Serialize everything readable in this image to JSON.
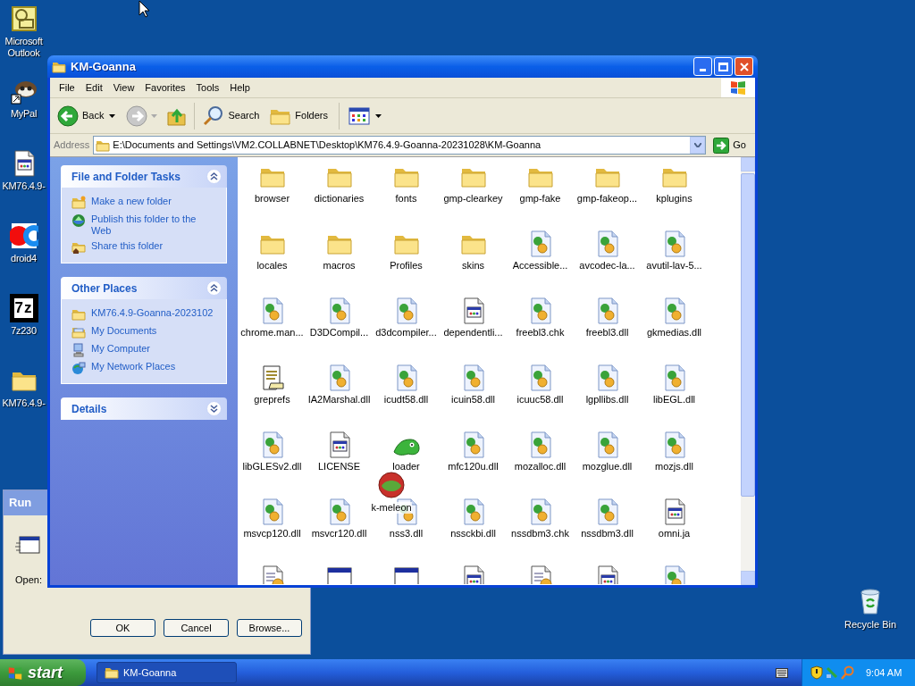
{
  "desktop_icons": [
    {
      "label": "Microsoft Outlook",
      "kind": "outlook"
    },
    {
      "label": "MyPal",
      "kind": "mypal"
    },
    {
      "label": "KM76.4.9-",
      "kind": "program"
    },
    {
      "label": "droid4",
      "kind": "droid"
    },
    {
      "label": "7z230",
      "kind": "sevenzip",
      "logo_text": "7z"
    },
    {
      "label": "KM76.4.9-",
      "kind": "folder"
    }
  ],
  "recycle_bin": {
    "label": "Recycle Bin"
  },
  "run_dialog": {
    "title": "Run",
    "open_label": "Open:",
    "buttons": [
      "OK",
      "Cancel",
      "Browse..."
    ]
  },
  "explorer": {
    "title": "KM-Goanna",
    "menu": [
      "File",
      "Edit",
      "View",
      "Favorites",
      "Tools",
      "Help"
    ],
    "toolbar": {
      "back": "Back",
      "search": "Search",
      "folders": "Folders"
    },
    "address": {
      "label": "Address",
      "value": "E:\\Documents and Settings\\VM2.COLLABNET\\Desktop\\KM76.4.9-Goanna-20231028\\KM-Goanna",
      "go": "Go"
    },
    "task_panels": [
      {
        "title": "File and Folder Tasks",
        "expanded": true,
        "items": [
          {
            "label": "Make a new folder",
            "kind": "new-folder"
          },
          {
            "label": "Publish this folder to the Web",
            "kind": "globe"
          },
          {
            "label": "Share this folder",
            "kind": "share"
          }
        ]
      },
      {
        "title": "Other Places",
        "expanded": true,
        "items": [
          {
            "label": "KM76.4.9-Goanna-2023102",
            "kind": "folder"
          },
          {
            "label": "My Documents",
            "kind": "documents"
          },
          {
            "label": "My Computer",
            "kind": "computer"
          },
          {
            "label": "My Network Places",
            "kind": "network"
          }
        ]
      },
      {
        "title": "Details",
        "expanded": false
      }
    ],
    "files": [
      {
        "name": "browser",
        "kind": "folder"
      },
      {
        "name": "dictionaries",
        "kind": "folder"
      },
      {
        "name": "fonts",
        "kind": "folder"
      },
      {
        "name": "gmp-clearkey",
        "kind": "folder"
      },
      {
        "name": "gmp-fake",
        "kind": "folder"
      },
      {
        "name": "gmp-fakeop...",
        "kind": "folder"
      },
      {
        "name": "kplugins",
        "kind": "folder"
      },
      {
        "name": "locales",
        "kind": "folder"
      },
      {
        "name": "macros",
        "kind": "folder"
      },
      {
        "name": "Profiles",
        "kind": "folder"
      },
      {
        "name": "skins",
        "kind": "folder"
      },
      {
        "name": "Accessible...",
        "kind": "dll"
      },
      {
        "name": "avcodec-la...",
        "kind": "dll"
      },
      {
        "name": "avutil-lav-5...",
        "kind": "dll"
      },
      {
        "name": "chrome.man...",
        "kind": "dll"
      },
      {
        "name": "D3DCompil...",
        "kind": "dll"
      },
      {
        "name": "d3dcompiler...",
        "kind": "dll"
      },
      {
        "name": "dependentli...",
        "kind": "doc"
      },
      {
        "name": "freebl3.chk",
        "kind": "dll"
      },
      {
        "name": "freebl3.dll",
        "kind": "dll"
      },
      {
        "name": "gkmedias.dll",
        "kind": "dll"
      },
      {
        "name": "greprefs",
        "kind": "text"
      },
      {
        "name": "IA2Marshal.dll",
        "kind": "dll"
      },
      {
        "name": "icudt58.dll",
        "kind": "dll"
      },
      {
        "name": "icuin58.dll",
        "kind": "dll"
      },
      {
        "name": "icuuc58.dll",
        "kind": "dll"
      },
      {
        "name": "lgpllibs.dll",
        "kind": "dll"
      },
      {
        "name": "libEGL.dll",
        "kind": "dll"
      },
      {
        "name": "libGLESv2.dll",
        "kind": "dll"
      },
      {
        "name": "LICENSE",
        "kind": "doc"
      },
      {
        "name": "loader",
        "kind": "lizard"
      },
      {
        "name": "mfc120u.dll",
        "kind": "dll"
      },
      {
        "name": "mozalloc.dll",
        "kind": "dll"
      },
      {
        "name": "mozglue.dll",
        "kind": "dll"
      },
      {
        "name": "mozjs.dll",
        "kind": "dll"
      },
      {
        "name": "msvcp120.dll",
        "kind": "dll"
      },
      {
        "name": "msvcr120.dll",
        "kind": "dll"
      },
      {
        "name": "nss3.dll",
        "kind": "dll"
      },
      {
        "name": "nssckbi.dll",
        "kind": "dll"
      },
      {
        "name": "nssdbm3.chk",
        "kind": "dll"
      },
      {
        "name": "nssdbm3.dll",
        "kind": "dll"
      },
      {
        "name": "omni.ja",
        "kind": "doc"
      }
    ],
    "partial_row": [
      {
        "kind": "config"
      },
      {
        "kind": "window"
      },
      {
        "kind": "window"
      },
      {
        "kind": "doc"
      },
      {
        "kind": "config"
      },
      {
        "kind": "doc"
      },
      {
        "kind": "dll"
      }
    ],
    "dragged_item": {
      "name": "k-meleon"
    }
  },
  "taskbar": {
    "start": "start",
    "tasks": [
      {
        "label": "KM-Goanna",
        "selected": true
      }
    ],
    "clock": "9:04 AM"
  }
}
